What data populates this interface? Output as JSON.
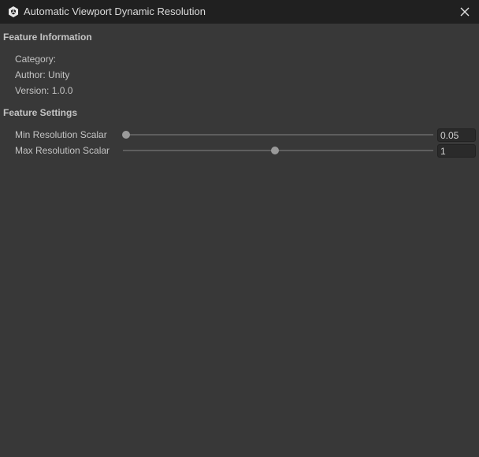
{
  "window": {
    "title": "Automatic Viewport Dynamic Resolution"
  },
  "feature_info": {
    "header": "Feature Information",
    "category": "Category:",
    "author": "Author: Unity",
    "version": "Version: 1.0.0"
  },
  "feature_settings": {
    "header": "Feature Settings",
    "min_scalar": {
      "label": "Min Resolution Scalar",
      "value": "0.05",
      "fraction": 0.01
    },
    "max_scalar": {
      "label": "Max Resolution Scalar",
      "value": "1",
      "fraction": 0.49
    }
  },
  "icons": {
    "app": "unity-logo-icon",
    "close": "close-icon"
  },
  "colors": {
    "background": "#383838",
    "titlebar": "#202020",
    "slider_track": "#5e5e5e",
    "slider_thumb": "#9a9a9a"
  }
}
